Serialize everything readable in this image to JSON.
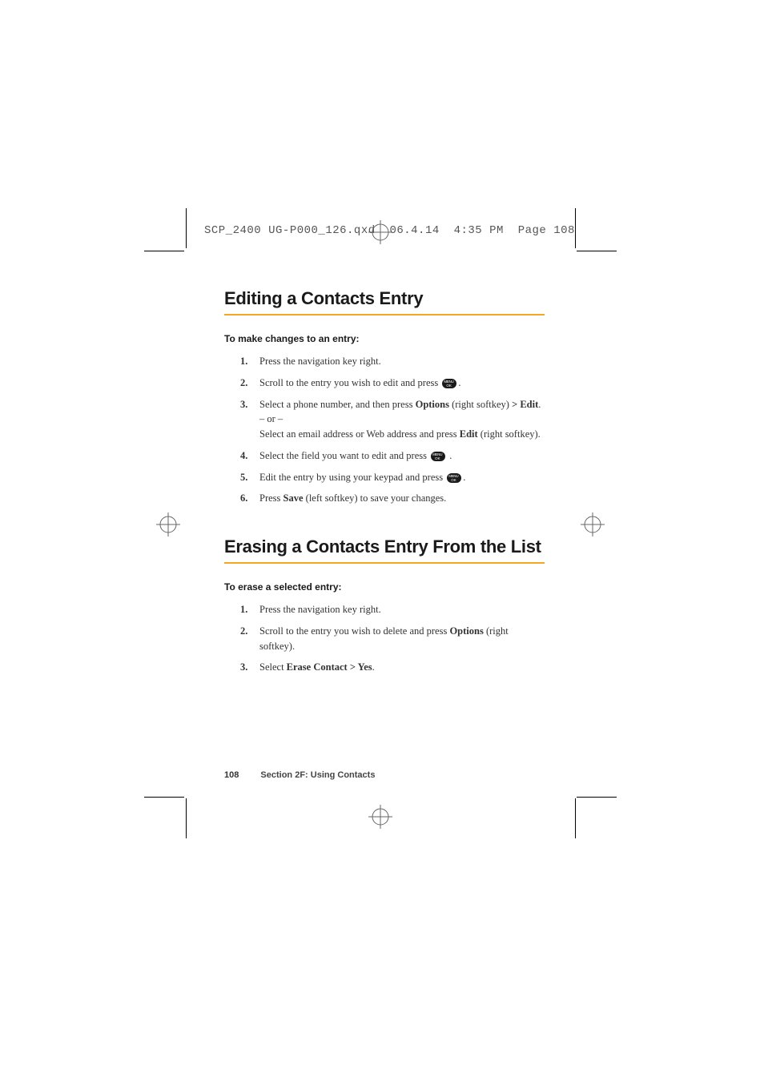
{
  "header": {
    "filename": "SCP_2400 UG-P000_126.qxd",
    "date": "06.4.14",
    "time": "4:35 PM",
    "page_label": "Page 108"
  },
  "section1": {
    "heading": "Editing a Contacts Entry",
    "subheading": "To make changes to an entry:",
    "steps": [
      {
        "num": "1.",
        "parts": [
          {
            "t": "Press the navigation key right."
          }
        ]
      },
      {
        "num": "2.",
        "parts": [
          {
            "t": "Scroll to the entry you wish to edit and press "
          },
          {
            "icon": true
          },
          {
            "t": "."
          }
        ]
      },
      {
        "num": "3.",
        "parts": [
          {
            "t": "Select a phone number, and then press "
          },
          {
            "b": "Options"
          },
          {
            "t": " (right softkey) "
          },
          {
            "b": "> Edit"
          },
          {
            "t": "."
          },
          {
            "br": true
          },
          {
            "t": "– or –"
          },
          {
            "br": true
          },
          {
            "t": "Select an email address or Web address and press "
          },
          {
            "b": "Edit"
          },
          {
            "t": " (right softkey)."
          }
        ]
      },
      {
        "num": "4.",
        "parts": [
          {
            "t": "Select the field you want to edit and press "
          },
          {
            "icon": true
          },
          {
            "t": " ."
          }
        ]
      },
      {
        "num": "5.",
        "parts": [
          {
            "t": "Edit the entry by using your keypad and press "
          },
          {
            "icon": true
          },
          {
            "t": "."
          }
        ]
      },
      {
        "num": "6.",
        "parts": [
          {
            "t": "Press "
          },
          {
            "b": "Save"
          },
          {
            "t": " (left softkey) to save your changes."
          }
        ]
      }
    ]
  },
  "section2": {
    "heading": "Erasing a Contacts Entry From the List",
    "subheading": "To erase a selected entry:",
    "steps": [
      {
        "num": "1.",
        "parts": [
          {
            "t": "Press the navigation key right."
          }
        ]
      },
      {
        "num": "2.",
        "parts": [
          {
            "t": "Scroll to the entry you wish to delete and press "
          },
          {
            "b": "Options"
          },
          {
            "t": " (right softkey)."
          }
        ]
      },
      {
        "num": "3.",
        "parts": [
          {
            "t": "Select "
          },
          {
            "b": "Erase Contact > Yes"
          },
          {
            "t": "."
          }
        ]
      }
    ]
  },
  "footer": {
    "page_num": "108",
    "section_text": "Section 2F: Using Contacts"
  }
}
